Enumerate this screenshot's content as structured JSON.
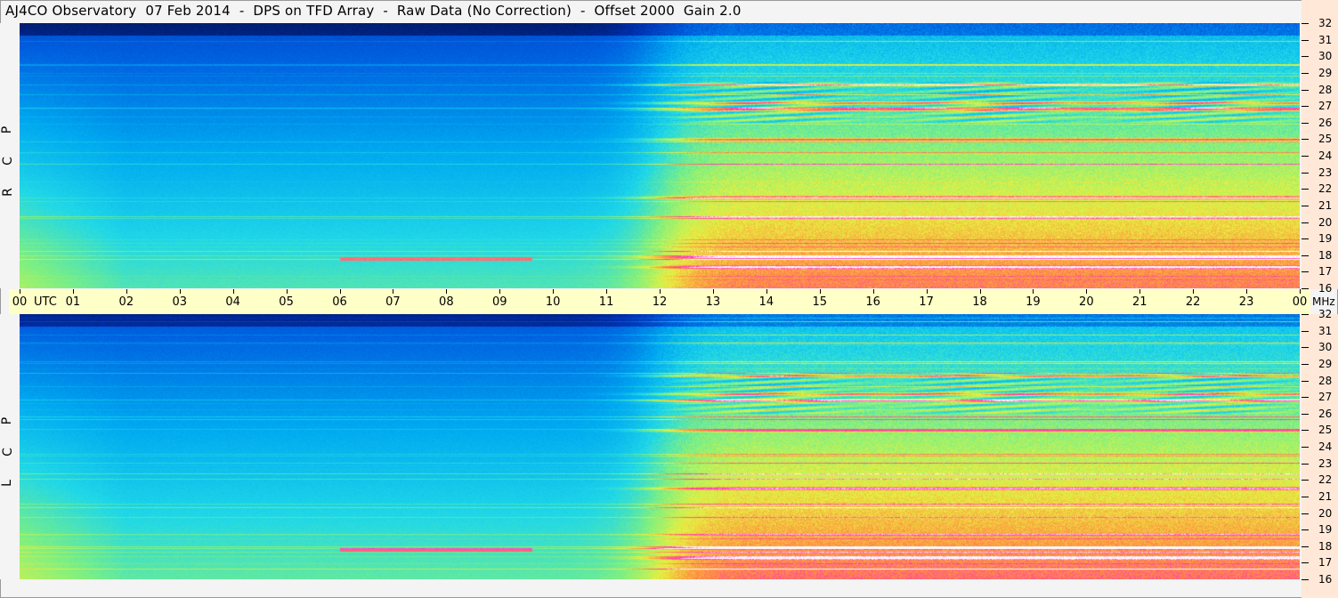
{
  "title": "AJ4CO Observatory  07 Feb 2014  -  DPS on TFD Array  -  Raw Data (No Correction)  -  Offset 2000  Gain 2.0",
  "colors": {
    "axis_band": "#ffffc8",
    "right_axis_bg": "#ffe8d8",
    "colormap": [
      "#000828",
      "#0030b0",
      "#0060e0",
      "#00a8f0",
      "#20d8e8",
      "#80f080",
      "#e8f040",
      "#ff9040",
      "#ff30c0",
      "#ffffff"
    ]
  },
  "chart_data": {
    "type": "heatmap",
    "description_of_axes": "dynamic spectrum",
    "x_axis": {
      "label": "UTC",
      "ticks": [
        "00",
        "01",
        "02",
        "03",
        "04",
        "05",
        "06",
        "07",
        "08",
        "09",
        "10",
        "11",
        "12",
        "13",
        "14",
        "15",
        "16",
        "17",
        "18",
        "19",
        "20",
        "21",
        "22",
        "23",
        "00"
      ],
      "range": [
        0,
        24
      ]
    },
    "y_axis": {
      "label": "MHz",
      "ticks": [
        16,
        17,
        18,
        19,
        20,
        21,
        22,
        23,
        24,
        25,
        26,
        27,
        28,
        29,
        30,
        31,
        32
      ],
      "range": [
        16,
        32
      ]
    },
    "panels": [
      {
        "name": "R C P",
        "polarization_label": "R C P"
      },
      {
        "name": "L C P",
        "polarization_label": "L C P"
      }
    ],
    "features": {
      "daytime_band_start_utc": 12,
      "strong_bands_mhz": [
        17.3,
        17.9,
        21.5,
        26.8,
        27.2,
        25.0,
        28.3
      ],
      "night_band_mhz": 17.8,
      "night_band_utc": [
        6,
        9.6
      ]
    }
  }
}
